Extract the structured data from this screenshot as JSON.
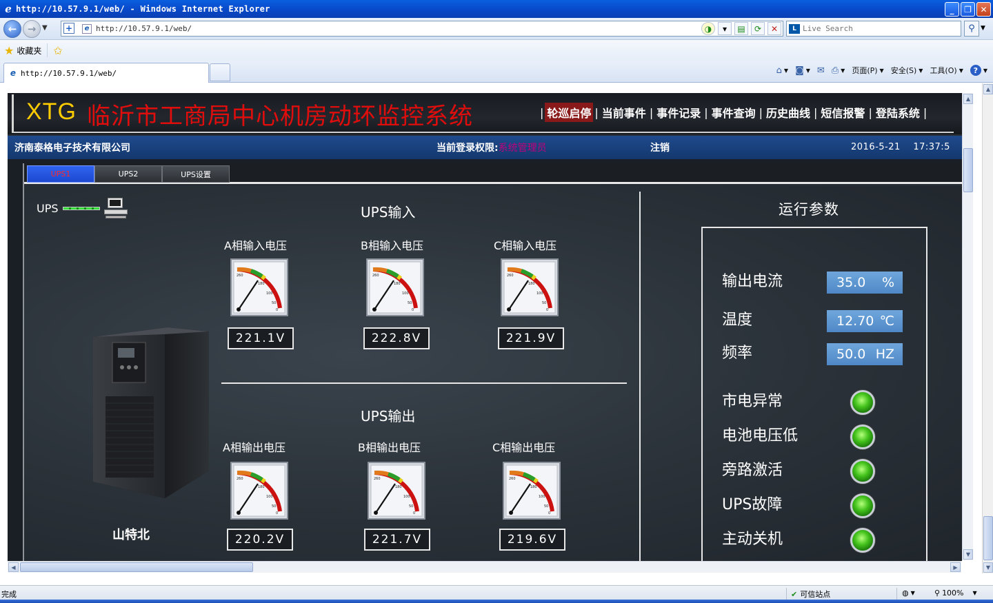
{
  "browser": {
    "window_title": "http://10.57.9.1/web/ - Windows Internet Explorer",
    "address": "http://10.57.9.1/web/",
    "search_placeholder": "Live Search",
    "favorites_label": "收藏夹",
    "tab_title": "http://10.57.9.1/web/",
    "commands": {
      "page": "页面(P)",
      "safety": "安全(S)",
      "tools": "工具(O)"
    },
    "status_left": "完成",
    "status_zone": "可信站点",
    "zoom": "100%"
  },
  "app": {
    "brand": "XTG",
    "title": "临沂市工商局中心机房动环监控系统",
    "nav": [
      {
        "label": "轮巡启停",
        "active": true
      },
      {
        "label": "当前事件"
      },
      {
        "label": "事件记录"
      },
      {
        "label": "事件查询"
      },
      {
        "label": "历史曲线"
      },
      {
        "label": "短信报警"
      },
      {
        "label": "登陆系统"
      }
    ],
    "company": "济南泰格电子技术有限公司",
    "permission_label": "当前登录权限:",
    "permission_role": "系统管理员",
    "logout_label": "注销",
    "date": "2016-5-21",
    "time": "17:37:5"
  },
  "tabs": [
    {
      "label": "UPS1",
      "active": true
    },
    {
      "label": "UPS2"
    },
    {
      "label": "UPS设置"
    }
  ],
  "ups": {
    "status_label": "UPS",
    "brand_label": "山特北",
    "input": {
      "title": "UPS输入",
      "meters": [
        {
          "label": "A相输入电压",
          "value": "221.1V"
        },
        {
          "label": "B相输入电压",
          "value": "222.8V"
        },
        {
          "label": "C相输入电压",
          "value": "221.9V"
        }
      ]
    },
    "output": {
      "title": "UPS输出",
      "meters": [
        {
          "label": "A相输出电压",
          "value": "220.2V"
        },
        {
          "label": "B相输出电压",
          "value": "221.7V"
        },
        {
          "label": "C相输出电压",
          "value": "219.6V"
        }
      ]
    }
  },
  "params": {
    "title": "运行参数",
    "values": [
      {
        "label": "输出电流",
        "value": "35.0",
        "unit": "%"
      },
      {
        "label": "温度",
        "value": "12.70",
        "unit": "℃"
      },
      {
        "label": "频率",
        "value": "50.0",
        "unit": "HZ"
      }
    ],
    "alarms": [
      {
        "label": "市电异常",
        "state": "normal"
      },
      {
        "label": "电池电压低",
        "state": "normal"
      },
      {
        "label": "旁路激活",
        "state": "normal"
      },
      {
        "label": "UPS故障",
        "state": "normal"
      },
      {
        "label": "主动关机",
        "state": "normal"
      }
    ]
  }
}
